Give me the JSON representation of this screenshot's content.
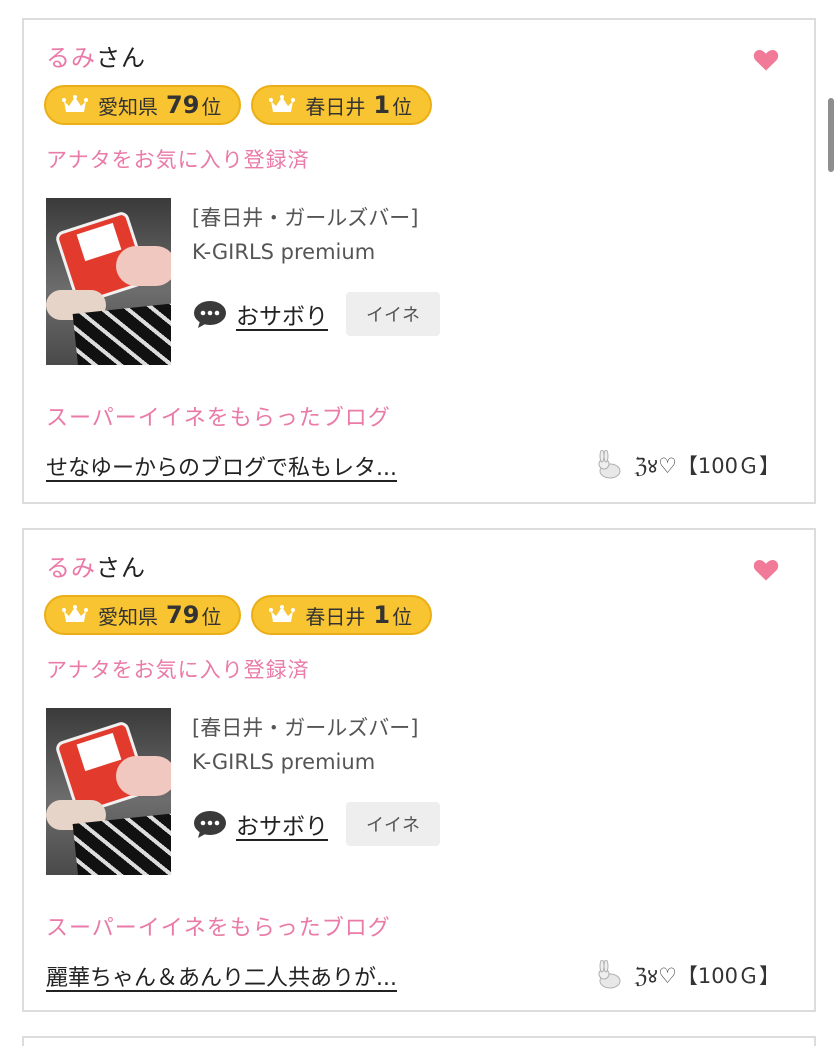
{
  "cards": [
    {
      "name_prefix": "るみ",
      "name_suffix": "さん",
      "badges": [
        {
          "area": "愛知県",
          "rank": "79",
          "unit": "位"
        },
        {
          "area": "春日井",
          "rank": "1",
          "unit": "位"
        }
      ],
      "favorite_status": "アナタをお気に入り登録済",
      "shop_category": "[春日井・ガールズバー]",
      "shop_name": "K-GIRLS premium",
      "blog_title": "おサボり",
      "iine_label": "イイネ",
      "super_title": "スーパーイイネをもらったブログ",
      "super_blog_link": "せなゆーからのブログで私もレタ...",
      "super_meta": "ℨ४♡【100Ｇ】"
    },
    {
      "name_prefix": "るみ",
      "name_suffix": "さん",
      "badges": [
        {
          "area": "愛知県",
          "rank": "79",
          "unit": "位"
        },
        {
          "area": "春日井",
          "rank": "1",
          "unit": "位"
        }
      ],
      "favorite_status": "アナタをお気に入り登録済",
      "shop_category": "[春日井・ガールズバー]",
      "shop_name": "K-GIRLS premium",
      "blog_title": "おサボり",
      "iine_label": "イイネ",
      "super_title": "スーパーイイネをもらったブログ",
      "super_blog_link": "麗華ちゃん＆あんり二人共ありが...",
      "super_meta": "ℨ४♡【100Ｇ】"
    }
  ],
  "colors": {
    "accent_pink": "#ea7aa7",
    "badge_gold": "#f8c431",
    "heart": "#f07a97"
  },
  "icons": [
    "heart-icon",
    "crown-icon",
    "chat-bubble-icon",
    "rabbit-icon"
  ]
}
